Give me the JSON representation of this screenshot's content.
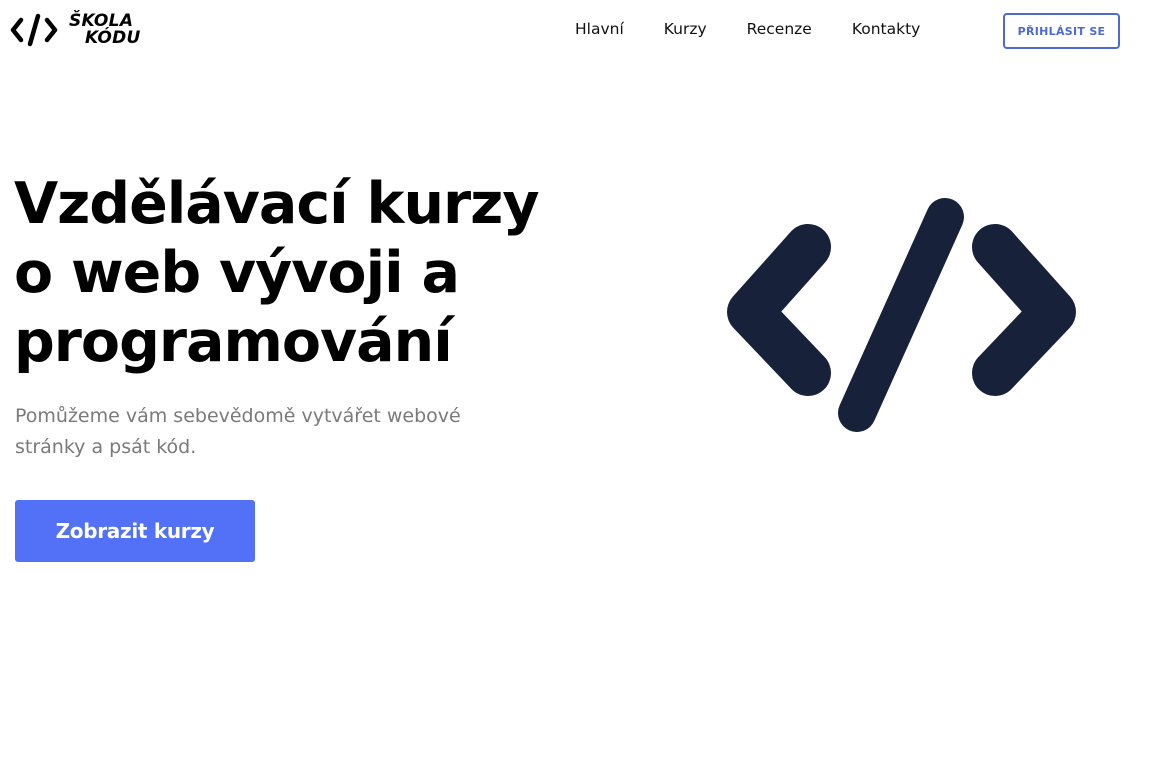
{
  "header": {
    "logo": {
      "icon": "code-brackets-icon",
      "line1": "ŠKOLA",
      "line2": "KÓDU"
    },
    "nav": [
      {
        "label": "Hlavní"
      },
      {
        "label": "Kurzy"
      },
      {
        "label": "Recenze"
      },
      {
        "label": "Kontakty"
      }
    ],
    "login_label": "PŘIHLÁSIT SE"
  },
  "hero": {
    "title_lines": [
      "Vzdělávací kurzy",
      "o web vývoji a",
      "programování"
    ],
    "subtitle": "Pomůžeme vám sebevědomě vytvářet webové stránky a psát kód.",
    "cta_label": "Zobrazit kurzy",
    "illustration_icon": "code-brackets-icon"
  },
  "colors": {
    "accent": "#5271f7",
    "login_border": "#4e6ad0",
    "illustration": "#18213a",
    "subtitle_text": "#7a7a7a"
  }
}
